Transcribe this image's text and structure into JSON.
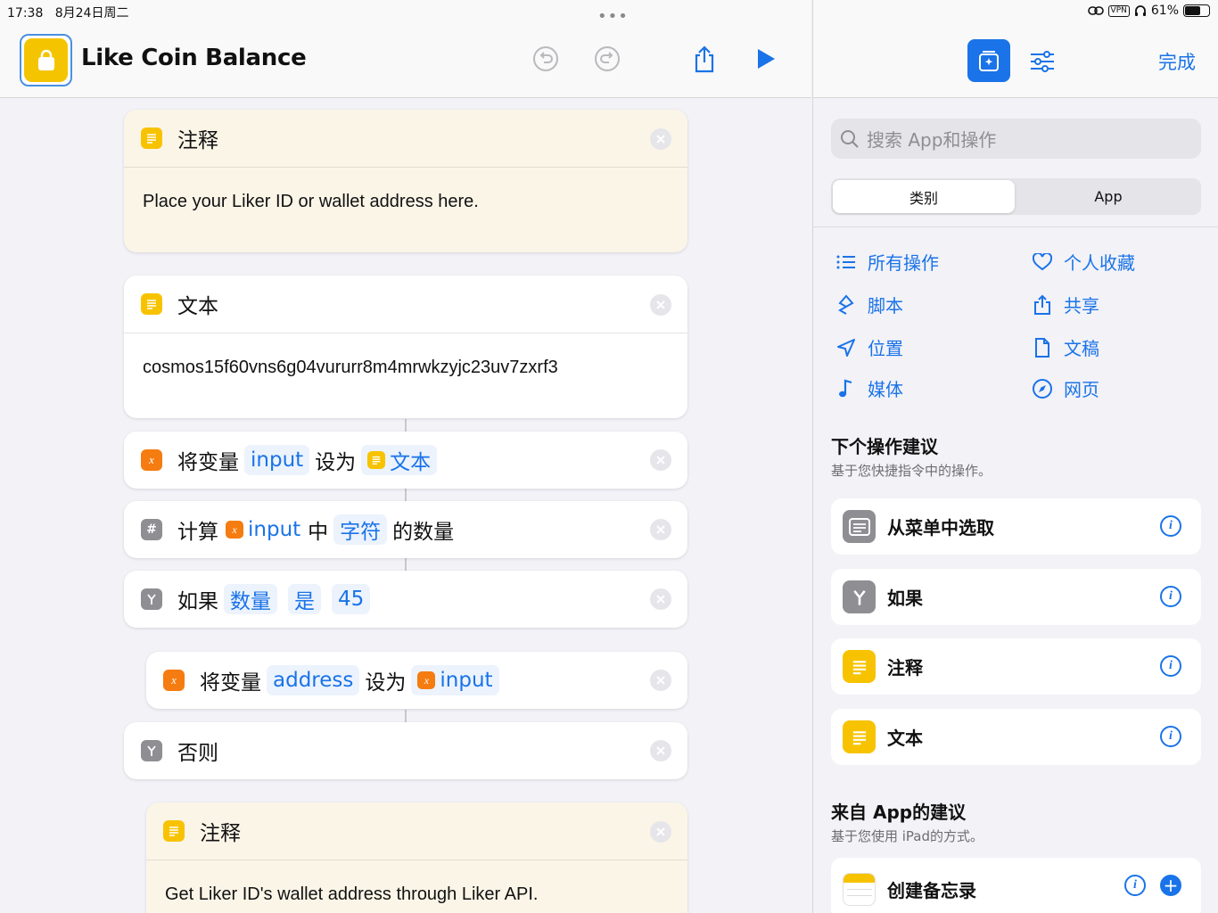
{
  "status_bar": {
    "time": "17:38",
    "date": "8月24日周二",
    "vpn": "VPN",
    "battery": "61%",
    "battery_level": 0.61
  },
  "header": {
    "title": "Like Coin Balance",
    "grabber": "•••"
  },
  "actions": [
    {
      "title": "注释",
      "body": "Place your Liker ID or wallet address here."
    },
    {
      "title": "文本",
      "body": "cosmos15f60vns6g04vururr8m4mrwkzyjc23uv7zxrf3"
    },
    {
      "parts": [
        "将变量",
        "input",
        "设为",
        "文本"
      ]
    },
    {
      "parts": [
        "计算",
        "input",
        "中",
        "字符",
        "的数量"
      ]
    },
    {
      "parts": [
        "如果",
        "数量",
        "是",
        "45"
      ]
    },
    {
      "parts": [
        "将变量",
        "address",
        "设为",
        "input"
      ]
    },
    {
      "title": "否则"
    },
    {
      "title": "注释",
      "body": "Get Liker ID's wallet address through Liker API."
    }
  ],
  "right_panel": {
    "done_label": "完成",
    "search_placeholder": "搜索 App和操作",
    "segments": [
      "类别",
      "App"
    ],
    "categories": [
      {
        "label": "所有操作",
        "icon": "list-icon"
      },
      {
        "label": "个人收藏",
        "icon": "heart-icon"
      },
      {
        "label": "脚本",
        "icon": "script-icon"
      },
      {
        "label": "共享",
        "icon": "share-icon"
      },
      {
        "label": "位置",
        "icon": "location-icon"
      },
      {
        "label": "文稿",
        "icon": "document-icon"
      },
      {
        "label": "媒体",
        "icon": "music-note-icon"
      },
      {
        "label": "网页",
        "icon": "compass-icon"
      }
    ],
    "next_title": "下个操作建议",
    "next_sub": "基于您快捷指令中的操作。",
    "suggestions": [
      "从菜单中选取",
      "如果",
      "注释",
      "文本"
    ],
    "app_title": "来自 App的建议",
    "app_sub": "基于您使用 iPad的方式。",
    "app_suggestions": [
      "创建备忘录"
    ]
  },
  "colors": {
    "accent": "#1a73e8",
    "comment_bg": "#fbf5e8",
    "yellow_icon": "#f7c300",
    "orange_icon": "#f57c10",
    "gray_icon": "#8e8e93"
  }
}
